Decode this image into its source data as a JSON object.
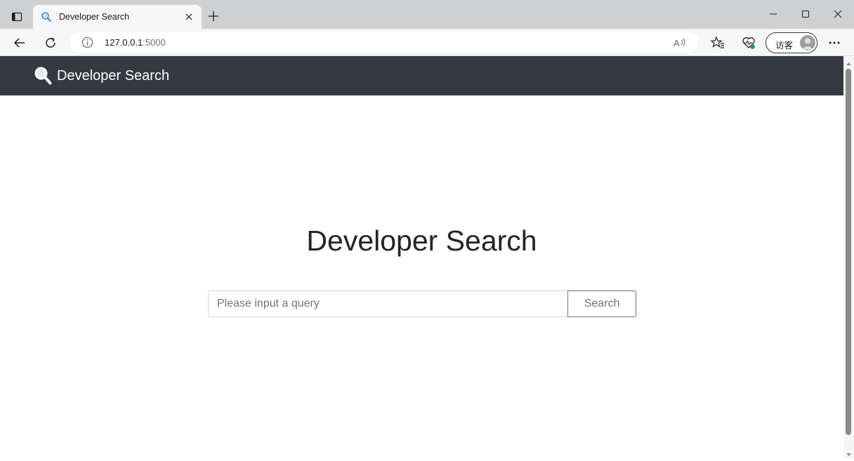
{
  "browser": {
    "tab_title": "Developer Search",
    "url_host": "127.0.0.1",
    "url_port": ":5000",
    "profile_label": "访客"
  },
  "page": {
    "brand": "Developer Search",
    "title": "Developer Search",
    "search": {
      "placeholder": "Please input a query",
      "value": "",
      "button_label": "Search"
    }
  },
  "colors": {
    "navbar": "#343a40",
    "button_outline": "#6c757d"
  }
}
